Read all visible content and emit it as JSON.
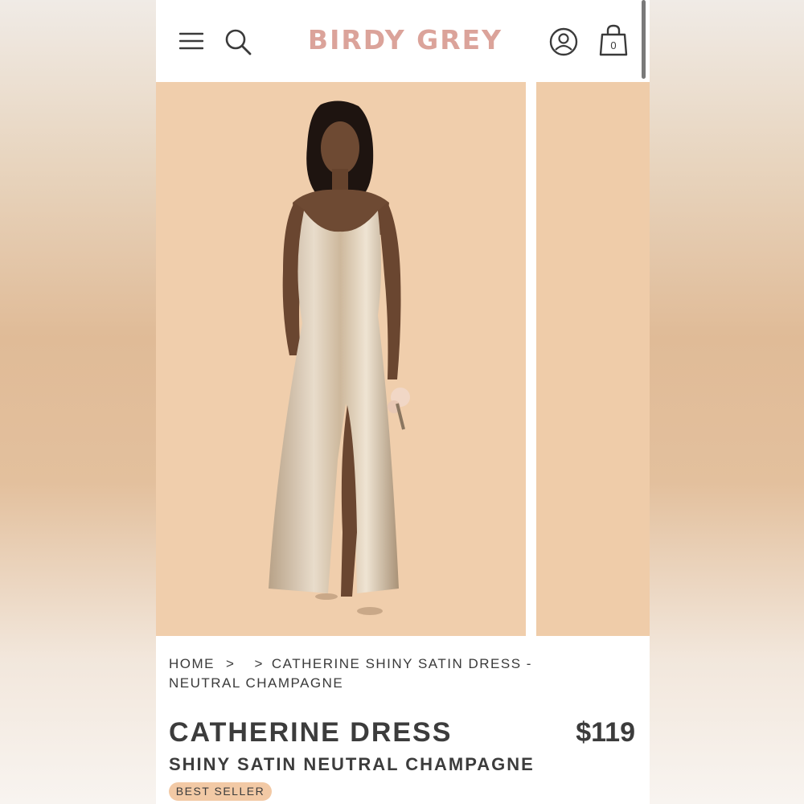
{
  "header": {
    "brand": "BIRDY GREY",
    "cart_count": "0",
    "icons": [
      "menu-icon",
      "search-icon",
      "account-icon",
      "shopping-bag-icon"
    ]
  },
  "breadcrumb": {
    "home": "HOME",
    "separator": ">",
    "current": "CATHERINE SHINY SATIN DRESS - NEUTRAL CHAMPAGNE"
  },
  "product": {
    "name": "CATHERINE DRESS",
    "price": "$119",
    "subtitle": "SHINY SATIN NEUTRAL CHAMPAGNE",
    "badge": "BEST SELLER"
  },
  "colors": {
    "brand": "#dba39a",
    "photo_background": "#f0ceac",
    "badge": "#f2c9a5",
    "text": "#3c3c3c"
  }
}
